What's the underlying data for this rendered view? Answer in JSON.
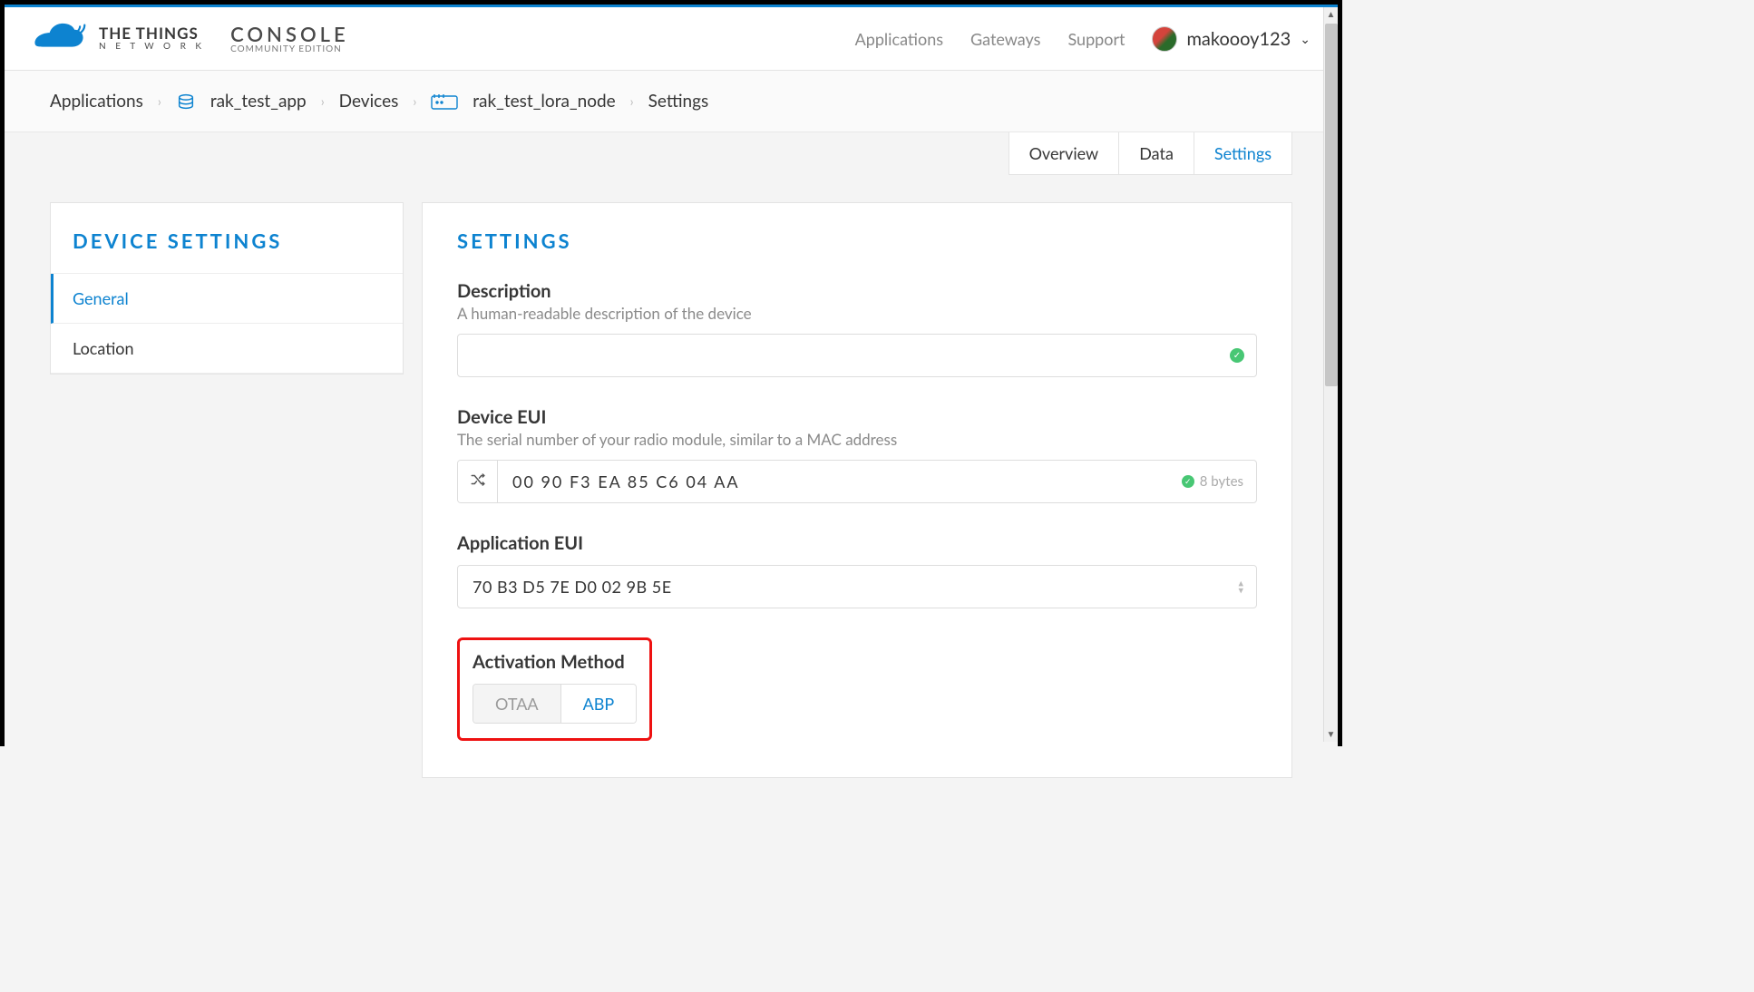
{
  "header": {
    "brand_line1": "THE THINGS",
    "brand_line2": "N E T W O R K",
    "console_line1": "CONSOLE",
    "console_line2": "COMMUNITY EDITION",
    "nav": {
      "applications": "Applications",
      "gateways": "Gateways",
      "support": "Support"
    },
    "username": "makoooy123"
  },
  "breadcrumb": {
    "applications": "Applications",
    "app_name": "rak_test_app",
    "devices": "Devices",
    "device_name": "rak_test_lora_node",
    "settings": "Settings"
  },
  "tabs": {
    "overview": "Overview",
    "data": "Data",
    "settings": "Settings"
  },
  "sidebar": {
    "title": "DEVICE SETTINGS",
    "items": [
      "General",
      "Location"
    ]
  },
  "main": {
    "title": "SETTINGS",
    "description": {
      "label": "Description",
      "help": "A human-readable description of the device",
      "value": ""
    },
    "device_eui": {
      "label": "Device EUI",
      "help": "The serial number of your radio module, similar to a MAC address",
      "value": "00  90  F3  EA  85  C6  04  AA",
      "bytes": "8 bytes"
    },
    "app_eui": {
      "label": "Application EUI",
      "value": "70 B3 D5 7E D0 02 9B 5E"
    },
    "activation": {
      "label": "Activation Method",
      "otaa": "OTAA",
      "abp": "ABP"
    }
  }
}
